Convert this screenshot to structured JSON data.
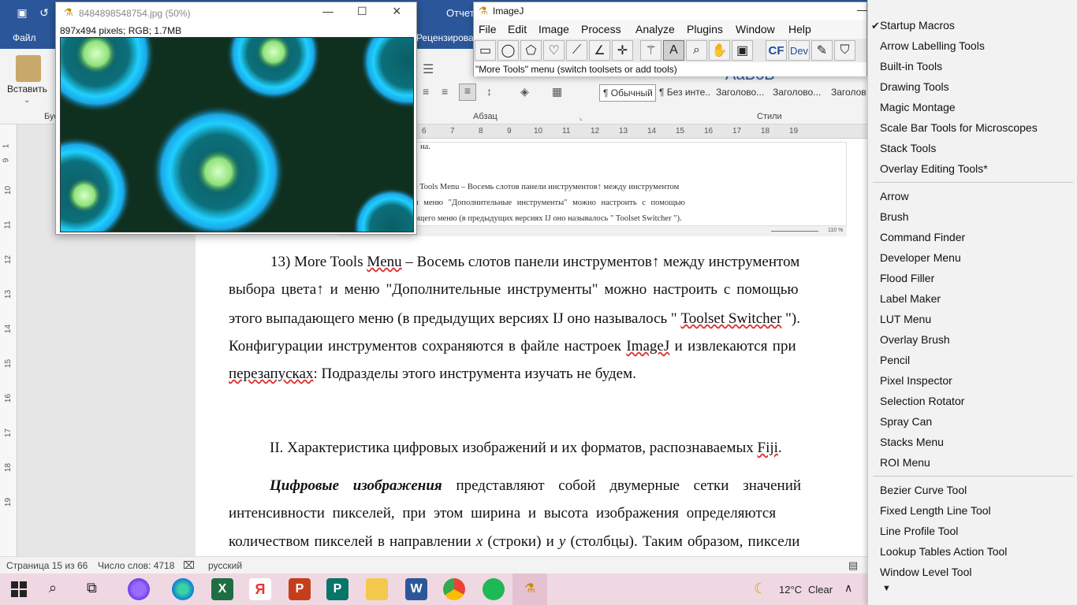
{
  "word": {
    "titlebar_text": "Отчет",
    "tabs": [
      "Файл",
      "Рецензирован"
    ],
    "ribbon": {
      "paste_label": "Вставить",
      "clipboard_label": "Бус",
      "paragraph_label": "Абзац",
      "styles_label": "Стили",
      "styles": [
        "¶ Обычный",
        "¶ Без инте...",
        "Заголово...",
        "Заголово...",
        "Заголов"
      ],
      "style_preview_text": "АаБбВ"
    },
    "hruler_numbers": [
      "6",
      "7",
      "8",
      "9",
      "10",
      "11",
      "12",
      "13",
      "14",
      "15",
      "16",
      "17",
      "18",
      "19"
    ],
    "vruler_numbers": [
      "1",
      "9",
      "10",
      "11",
      "12",
      "13",
      "14",
      "15",
      "16",
      "17",
      "18",
      "19"
    ],
    "thumbnail": {
      "line0": "на.",
      "line1": "e Tools Menu – Восемь слотов панели инструментов↑ между инструментом",
      "line2": "и меню \"Дополнительные инструменты\" можно настроить с помощью",
      "line3": "ощего меню (в предыдущих версиях IJ оно называлось \" Toolset Switcher \").",
      "zoom": "110 %"
    },
    "doc": {
      "p1_l1_a": "13) More Tools ",
      "p1_l1_menu": "Menu",
      "p1_l1_b": " – Восемь слотов панели инструментов↑ между инструментом",
      "p1_l2": "выбора цвета↑ и меню \"Дополнительные инструменты\" можно настроить с помощью",
      "p1_l3_a": "этого выпадающего меню (в предыдущих версиях IJ оно называлось \" ",
      "p1_l3_ts": "Toolset Switcher",
      "p1_l3_b": " \").",
      "p1_l4_a": "Конфигурации инструментов сохраняются в файле настроек ",
      "p1_l4_ij": "ImageJ",
      "p1_l4_b": " и извлекаются при",
      "p1_l5_a": "перезапусках",
      "p1_l5_b": ": Подразделы этого инструмента изучать не будем.",
      "h2_a": "II. Характеристика цифровых изображений и их форматов, распознаваемых ",
      "h2_fiji": "Fiji",
      "h2_b": ".",
      "p2_bold": "Цифровые изображения",
      "p2_l1": " представляют собой двумерные сетки значений",
      "p2_l2": "интенсивности пикселей, при этом ширина и высота изображения определяются",
      "p2_l3_a": "количеством пикселей в направлении ",
      "p2_l3_x": "x",
      "p2_l3_b": " (строки) и ",
      "p2_l3_y": "y",
      "p2_l3_c": " (столбцы). Таким образом, пиксели"
    },
    "status": {
      "page": "Страница 15 из 66",
      "words": "Число слов: 4718",
      "lang": "русский"
    }
  },
  "image_window": {
    "title": "8484898548754.jpg (50%)",
    "info": "897x494 pixels; RGB; 1.7MB"
  },
  "imagej": {
    "title": "ImageJ",
    "menu": [
      "File",
      "Edit",
      "Image",
      "Process",
      "Analyze",
      "Plugins",
      "Window",
      "Help"
    ],
    "tool_labels": [
      "CF",
      "Dev"
    ],
    "status": "\"More Tools\" menu (switch toolsets or add tools)"
  },
  "dropdown": {
    "group1": [
      "Startup Macros",
      "Arrow Labelling Tools",
      "Built-in Tools",
      "Drawing Tools",
      "Magic Montage",
      "Scale Bar Tools for Microscopes",
      "Stack Tools",
      "Overlay Editing Tools*"
    ],
    "checked": "Startup Macros",
    "group2": [
      "Arrow",
      "Brush",
      "Command Finder",
      "Developer Menu",
      "Flood Filler",
      "Label Maker",
      "LUT Menu",
      "Overlay Brush",
      "Pencil",
      "Pixel Inspector",
      "Selection Rotator",
      "Spray Can",
      "Stacks Menu",
      "ROI Menu"
    ],
    "group3": [
      "Bezier Curve Tool",
      "Fixed Length Line Tool",
      "Line Profile Tool",
      "Lookup Tables Action Tool",
      "Window Level Tool"
    ]
  },
  "taskbar": {
    "weather_temp": "12°C",
    "weather_desc": "Clear"
  }
}
